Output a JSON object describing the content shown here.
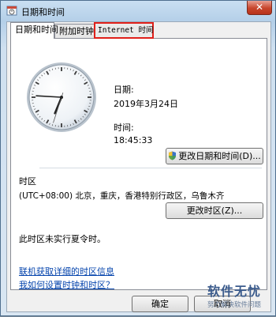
{
  "window": {
    "title": "日期和时间",
    "close_glyph": "✕"
  },
  "tabs": [
    {
      "label": "日期和时间"
    },
    {
      "label": "附加时钟"
    },
    {
      "label": "Internet 时间"
    }
  ],
  "date": {
    "label": "日期:",
    "value": "2019年3月24日"
  },
  "time": {
    "label": "时间:",
    "value": "18:45:33"
  },
  "change_datetime_button": "更改日期和时间(D)...",
  "timezone": {
    "section_label": "时区",
    "value": "(UTC+08:00) 北京，重庆，香港特别行政区，乌鲁木齐",
    "change_button": "更改时区(Z)...",
    "dst_note": "此时区未实行夏令时。"
  },
  "links": [
    {
      "text": "联机获取详细的时区信息"
    },
    {
      "text": "我如何设置时钟和时区？"
    }
  ],
  "footer": {
    "ok_label": "确定",
    "cancel_label": "取消"
  },
  "watermark": {
    "main": "软件无忧",
    "sub": "努力解决软件问题"
  },
  "colors": {
    "highlight": "#e0201a",
    "link": "#0645ad"
  }
}
